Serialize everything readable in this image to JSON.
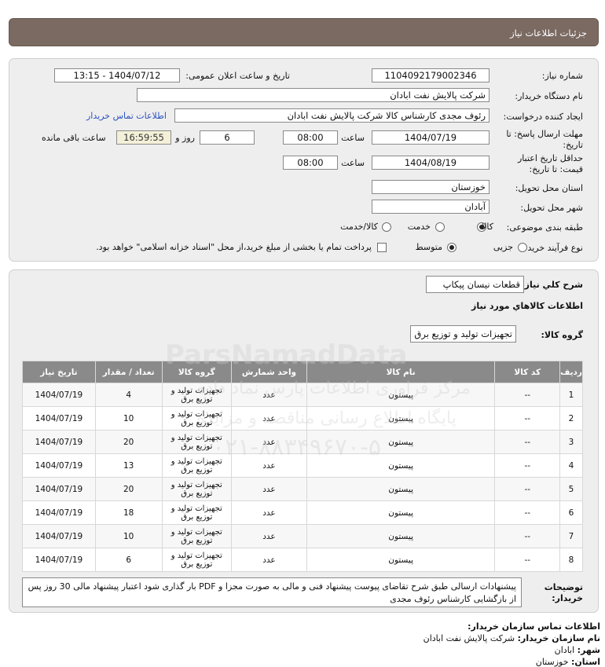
{
  "header": {
    "title": "جزئیات اطلاعات نیاز"
  },
  "form": {
    "need_number_label": "شماره نیاز:",
    "need_number": "1104092179002346",
    "announce_label": "تاریخ و ساعت اعلان عمومی:",
    "announce_value": "1404/07/12 - 13:15",
    "buyer_label": "نام دستگاه خریدار:",
    "buyer_value": "شرکت پالایش نفت ابادان",
    "creator_label": "ایجاد کننده درخواست:",
    "creator_value": "رئوف مجدی کارشناس کالا شرکت پالایش نفت ابادان",
    "contact_link": "اطلاعات تماس خریدار",
    "reply_label_1": "مهلت ارسال پاسخ: تا",
    "reply_label_2": "تاریخ:",
    "reply_date": "1404/07/19",
    "time_label": "ساعت",
    "reply_time": "08:00",
    "days_value": "6",
    "days_label": "روز و",
    "remaining_time": "16:59:55",
    "remaining_label": "ساعت باقی مانده",
    "price_label_1": "حداقل تاریخ اعتبار",
    "price_label_2": "قیمت: تا تاریخ:",
    "price_date": "1404/08/19",
    "price_time": "08:00",
    "province_label": "استان محل تحویل:",
    "province_value": "خوزستان",
    "city_label": "شهر محل تحویل:",
    "city_value": "آبادان",
    "category_label": "طبقه بندی موضوعی:",
    "category_options": [
      "کالا",
      "خدمت",
      "کالا/خدمت"
    ],
    "process_label": "نوع فرآیند خرید :",
    "process_options": [
      "جزیی",
      "متوسط"
    ],
    "treasury_text": "پرداخت تمام یا بخشی از مبلغ خرید،از محل \"اسناد خزانه اسلامی\" خواهد بود."
  },
  "summary": {
    "label": "شرح کلي نياز:",
    "value": "قطعات نیسان پیکاپ",
    "goods_info_label": "اطلاعات كالاهاي مورد نياز",
    "group_label": "گروه کالا:",
    "group_value": "تجهیزات تولید و توزیع برق"
  },
  "table": {
    "headers": [
      "ردیف",
      "کد کالا",
      "نام کالا",
      "واحد شمارش",
      "گروه کالا",
      "تعداد / مقدار",
      "تاریخ نیاز"
    ],
    "rows": [
      {
        "row": "1",
        "code": "--",
        "name": "پیستون",
        "unit": "عدد",
        "group": "تجهیزات تولید و توزیع برق",
        "qty": "4",
        "date": "1404/07/19"
      },
      {
        "row": "2",
        "code": "--",
        "name": "پیستون",
        "unit": "عدد",
        "group": "تجهیزات تولید و توزیع برق",
        "qty": "10",
        "date": "1404/07/19"
      },
      {
        "row": "3",
        "code": "--",
        "name": "پیستون",
        "unit": "عدد",
        "group": "تجهیزات تولید و توزیع برق",
        "qty": "20",
        "date": "1404/07/19"
      },
      {
        "row": "4",
        "code": "--",
        "name": "پیستون",
        "unit": "عدد",
        "group": "تجهیزات تولید و توزیع برق",
        "qty": "13",
        "date": "1404/07/19"
      },
      {
        "row": "5",
        "code": "--",
        "name": "پیستون",
        "unit": "عدد",
        "group": "تجهیزات تولید و توزیع برق",
        "qty": "20",
        "date": "1404/07/19"
      },
      {
        "row": "6",
        "code": "--",
        "name": "پیستون",
        "unit": "عدد",
        "group": "تجهیزات تولید و توزیع برق",
        "qty": "18",
        "date": "1404/07/19"
      },
      {
        "row": "7",
        "code": "--",
        "name": "پیستون",
        "unit": "عدد",
        "group": "تجهیزات تولید و توزیع برق",
        "qty": "10",
        "date": "1404/07/19"
      },
      {
        "row": "8",
        "code": "--",
        "name": "پیستون",
        "unit": "عدد",
        "group": "تجهیزات تولید و توزیع برق",
        "qty": "6",
        "date": "1404/07/19"
      }
    ]
  },
  "notes": {
    "label_1": "توضیحات",
    "label_2": "خریدار:",
    "text": "پیشنهادات ارسالی طبق شرح تقاضای پیوست پیشنهاد فنی و مالی به صورت مجزا و PDF بار گذاری شود اعتبار پیشنهاد مالی 30 روز پس از بازگشایی کارشناس رئوف مجدی"
  },
  "contact": {
    "title": "اطلاعات تماس سازمان خریدار:",
    "org_label": "نام سازمان خریدار:",
    "org_value": "شرکت پالایش نفت ابادان",
    "city_label": "شهر:",
    "city_value": "ابادان",
    "province_label": "استان:",
    "province_value": "خوزستان"
  },
  "watermark": {
    "brand": "ParsNamadData",
    "phone": "۰۲۱-۸۸۳۴۹۶۷۰-۵",
    "line1": "مرکز فراوری اطلاعات پارس نماد داده",
    "line2": "پایگاه اطلاع رسانی مناقصه و مزایده"
  }
}
